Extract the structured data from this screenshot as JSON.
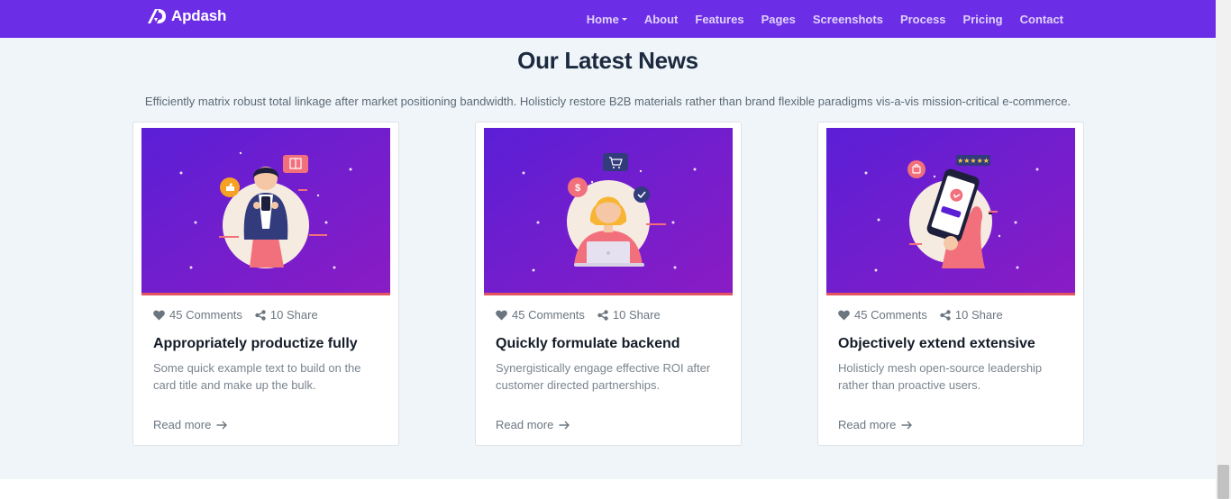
{
  "brand": {
    "name": "Apdash"
  },
  "nav": {
    "items": [
      {
        "label": "Home",
        "dropdown": true
      },
      {
        "label": "About"
      },
      {
        "label": "Features"
      },
      {
        "label": "Pages"
      },
      {
        "label": "Screenshots"
      },
      {
        "label": "Process"
      },
      {
        "label": "Pricing"
      },
      {
        "label": "Contact"
      }
    ]
  },
  "news": {
    "title": "Our Latest News",
    "description": "Efficiently matrix robust total linkage after market positioning bandwidth. Holisticly restore B2B materials rather than brand flexible paradigms vis-a-vis mission-critical e-commerce.",
    "cards": [
      {
        "comments": "45 Comments",
        "share": "10 Share",
        "title": "Appropriately productize fully",
        "text": "Some quick example text to build on the card title and make up the bulk.",
        "read_more": "Read more"
      },
      {
        "comments": "45 Comments",
        "share": "10 Share",
        "title": "Quickly formulate backend",
        "text": "Synergistically engage effective ROI after customer directed partnerships.",
        "read_more": "Read more"
      },
      {
        "comments": "45 Comments",
        "share": "10 Share",
        "title": "Objectively extend extensive",
        "text": "Holisticly mesh open-source leadership rather than proactive users.",
        "read_more": "Read more"
      }
    ]
  },
  "icons": {
    "comments": "heart-icon",
    "share": "share-icon",
    "read_more": "arrow-right-icon"
  },
  "colors": {
    "navbar": "#6c2de6",
    "section_bg": "#eff5f8",
    "card_image_gradient_start": "#5b1fd6",
    "card_image_gradient_end": "#8a1cc4",
    "image_border": "#e2545f",
    "title": "#1c2a40"
  }
}
